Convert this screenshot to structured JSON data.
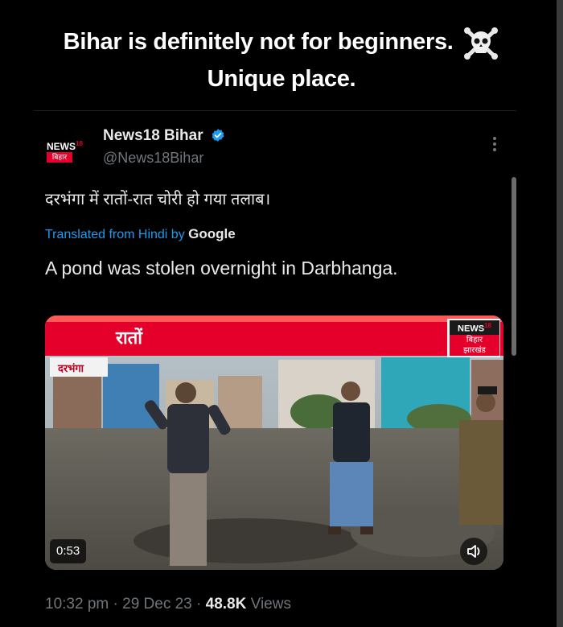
{
  "caption": {
    "line1": "Bihar is definitely not for beginners.",
    "line2": "Unique place.",
    "emoji": "skull-and-crossbones"
  },
  "tweet": {
    "author_name": "News18 Bihar",
    "author_handle": "@News18Bihar",
    "avatar_text_top": "NEWS",
    "avatar_text_sup": "18",
    "avatar_text_bottom": "बिहार",
    "original_text": "दरभंगा में रातों-रात चोरी हो गया तलाब।",
    "translated_label": "Translated from Hindi by",
    "translator": "Google",
    "translated_text": "A pond was stolen overnight in Darbhanga.",
    "time": "10:32 pm",
    "date": "29 Dec 23",
    "views_count": "48.8K",
    "views_label": "Views",
    "separator": "·"
  },
  "video": {
    "banner_text": "रातों",
    "location_tag": "दरभंगा",
    "logo_news": "NEWS",
    "logo_sup": "18",
    "logo_line2": "बिहार",
    "logo_line3": "झारखंड",
    "duration": "0:53",
    "icons": [
      "more-icon",
      "verified-icon",
      "volume-icon"
    ]
  },
  "colors": {
    "background": "#000000",
    "text": "#e7e9ea",
    "muted": "#71767b",
    "link": "#1d9bf0",
    "news_red": "#e4002b",
    "verified": "#1d9bf0"
  }
}
